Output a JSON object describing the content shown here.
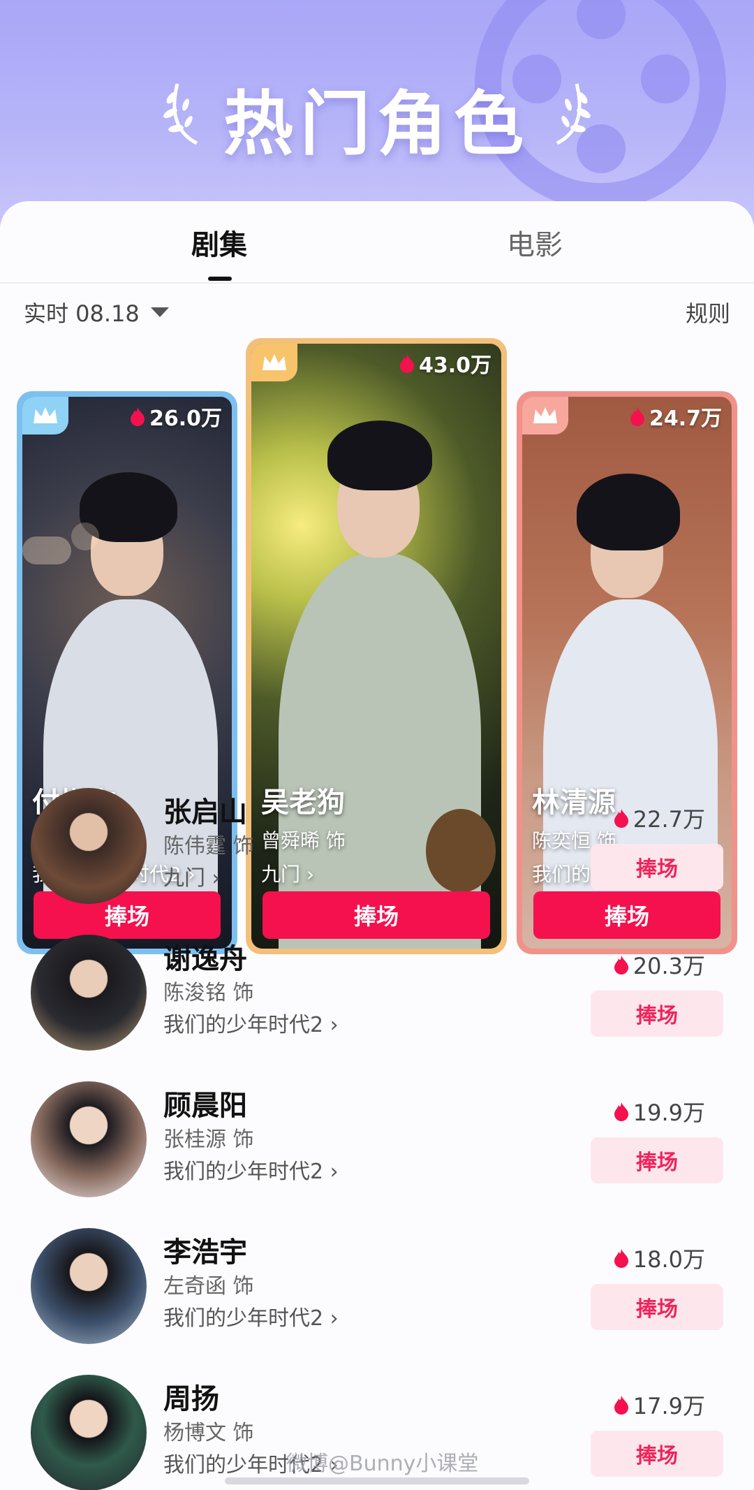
{
  "header": {
    "title": "热门角色"
  },
  "tabs": [
    {
      "label": "剧集",
      "active": true
    },
    {
      "label": "电影",
      "active": false
    }
  ],
  "subbar": {
    "date_label": "实时 08.18",
    "rules_label": "规则"
  },
  "colors": {
    "accent": "#f4114e",
    "button_soft": "#fde7ec",
    "hero_bg": "#b0adf8"
  },
  "top3": [
    {
      "rank": 2,
      "name": "付彬言",
      "actor": "王櫓杰 饰",
      "show": "我们的少年时代2 ›",
      "heat": "26.0万",
      "button": "捧场"
    },
    {
      "rank": 1,
      "name": "吴老狗",
      "actor": "曾舜晞 饰",
      "show": "九门 ›",
      "heat": "43.0万",
      "button": "捧场"
    },
    {
      "rank": 3,
      "name": "林清源",
      "actor": "陈奕恒 饰",
      "show": "我们的少年时代2 ›",
      "heat": "24.7万",
      "button": "捧场"
    }
  ],
  "list": [
    {
      "name": "张启山",
      "actor": "陈伟霆 饰",
      "show": "九门 ›",
      "heat": "22.7万",
      "button": "捧场"
    },
    {
      "name": "谢逸舟",
      "actor": "陈浚铭 饰",
      "show": "我们的少年时代2 ›",
      "heat": "20.3万",
      "button": "捧场"
    },
    {
      "name": "顾晨阳",
      "actor": "张桂源 饰",
      "show": "我们的少年时代2 ›",
      "heat": "19.9万",
      "button": "捧场"
    },
    {
      "name": "李浩宇",
      "actor": "左奇函 饰",
      "show": "我们的少年时代2 ›",
      "heat": "18.0万",
      "button": "捧场"
    },
    {
      "name": "周扬",
      "actor": "杨博文 饰",
      "show": "我们的少年时代2 ›",
      "heat": "17.9万",
      "button": "捧场"
    }
  ],
  "watermark": "微博@Bunny小课堂"
}
